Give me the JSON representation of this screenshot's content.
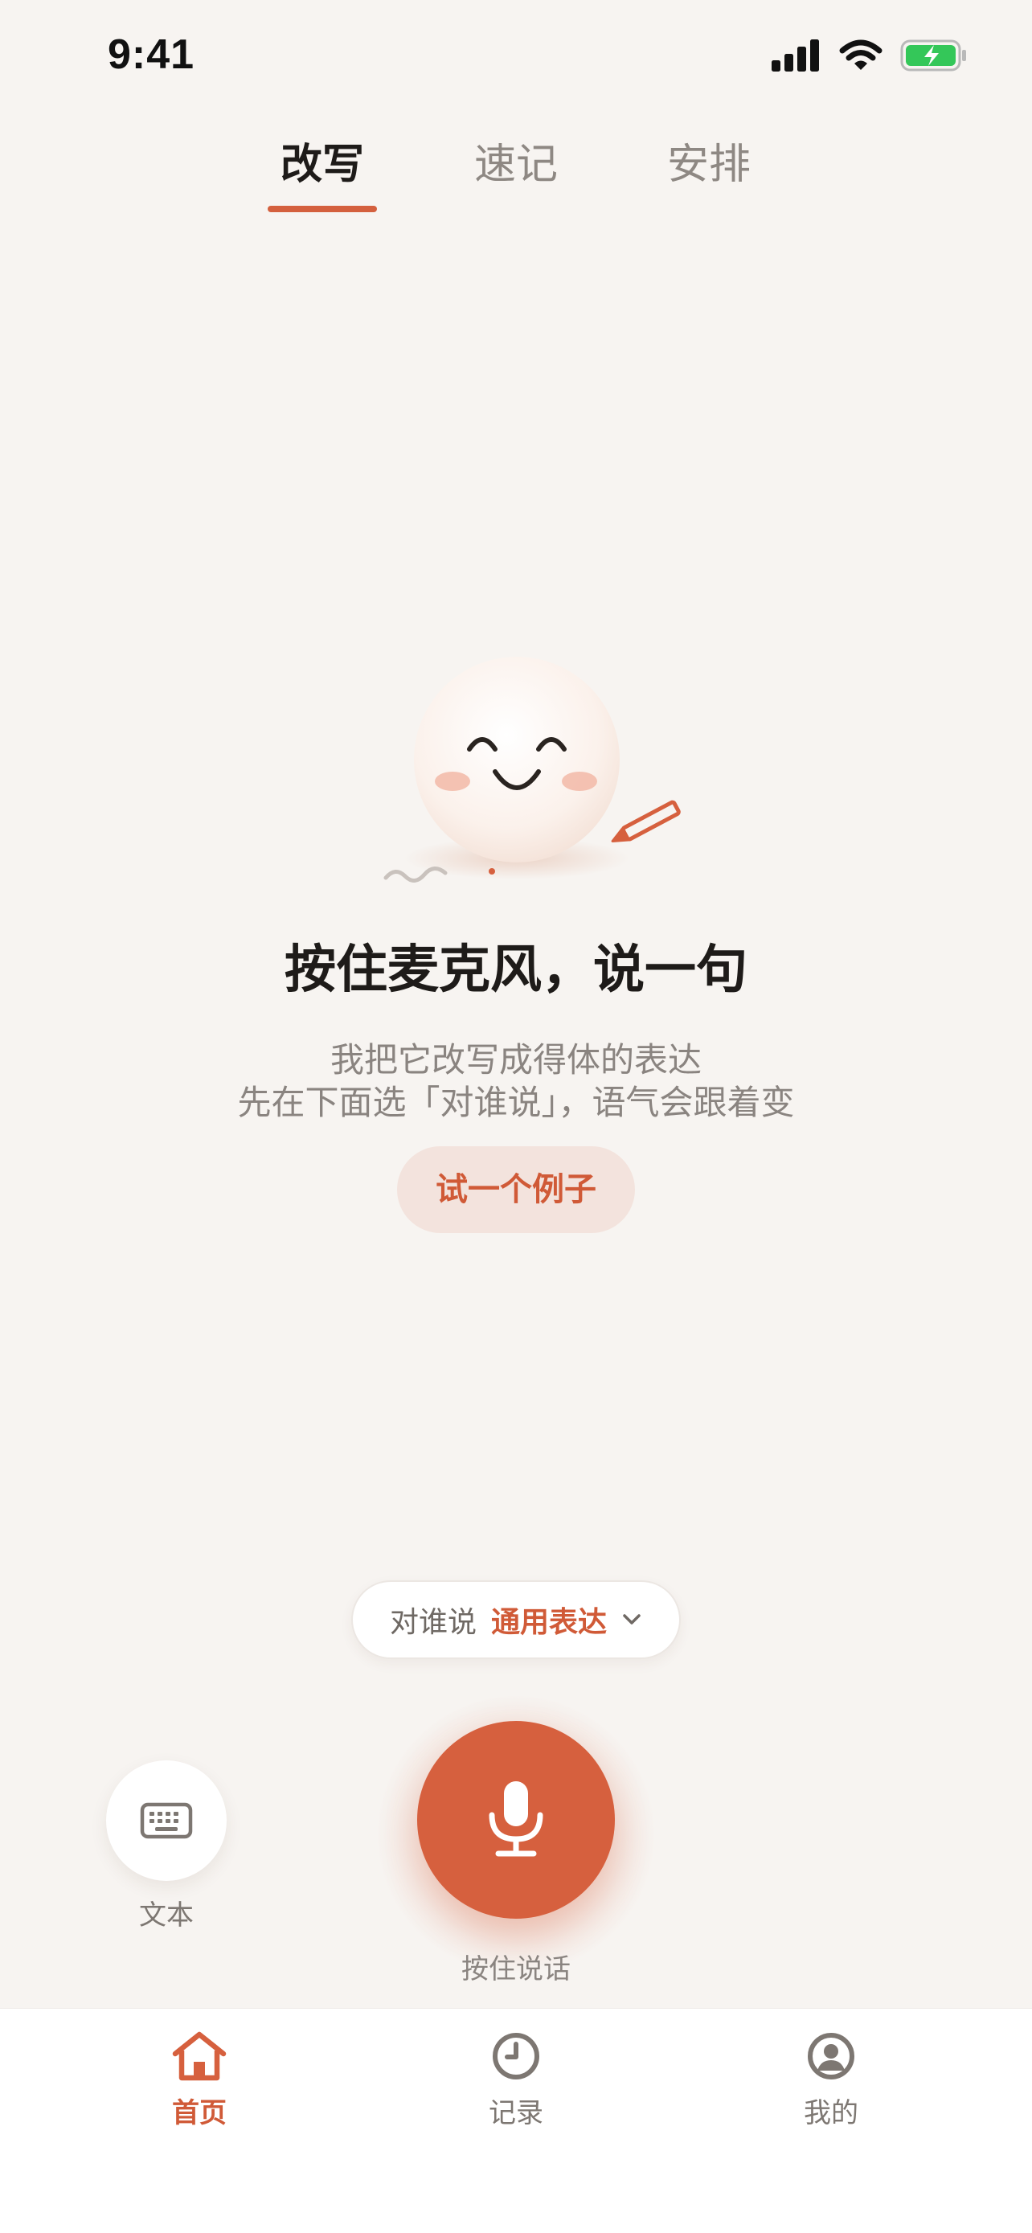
{
  "status_bar": {
    "time": "9:41"
  },
  "top_tabs": [
    {
      "label": "改写",
      "active": true
    },
    {
      "label": "速记",
      "active": false
    },
    {
      "label": "安排",
      "active": false
    }
  ],
  "hero": {
    "headline": "按住麦克风，说一句",
    "subtitle_line1": "我把它改写成得体的表达",
    "subtitle_line2": "先在下面选「对谁说」，语气会跟着变",
    "example_button": "试一个例子"
  },
  "recipient": {
    "label": "对谁说",
    "value": "通用表达"
  },
  "mic": {
    "label": "按住说话"
  },
  "keyboard": {
    "label": "文本"
  },
  "bottom_nav": [
    {
      "label": "首页",
      "icon": "home-icon",
      "active": true
    },
    {
      "label": "记录",
      "icon": "clock-icon",
      "active": false
    },
    {
      "label": "我的",
      "icon": "profile-icon",
      "active": false
    }
  ],
  "colors": {
    "accent": "#D6603E",
    "background": "#F7F4F1",
    "text": "#1E1B19",
    "muted": "#8A8480",
    "battery": "#34C759"
  }
}
